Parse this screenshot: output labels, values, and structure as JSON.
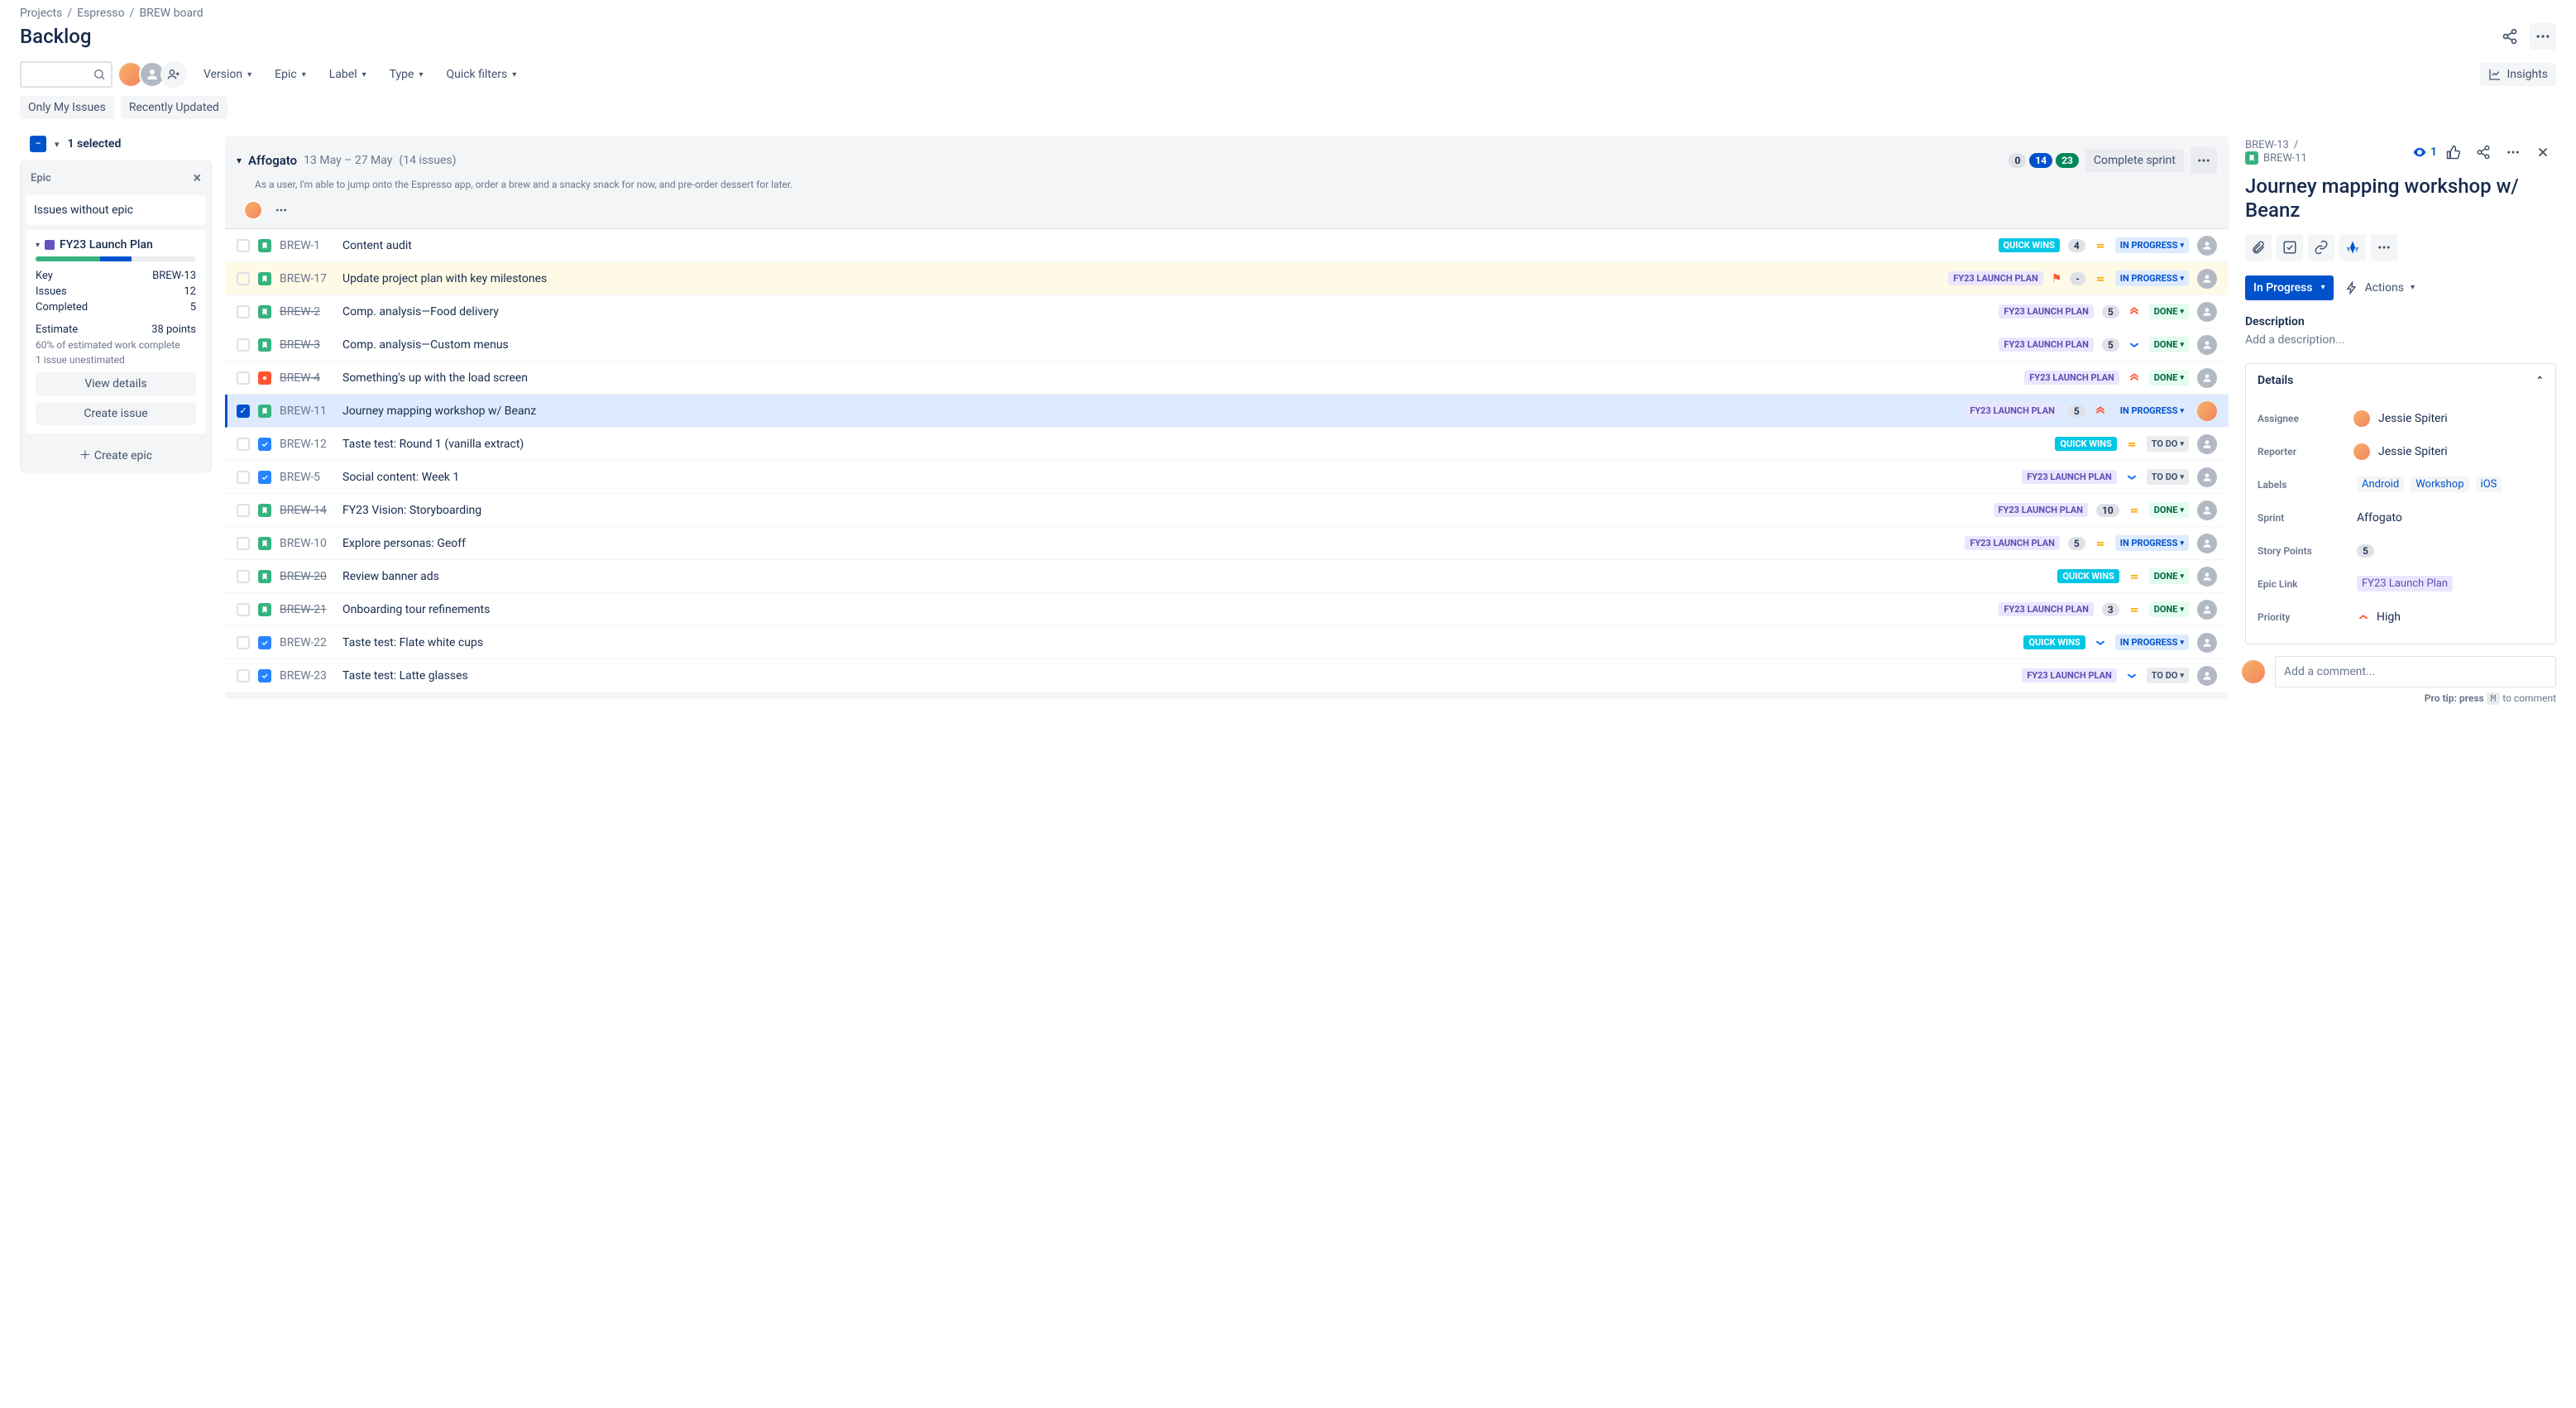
{
  "breadcrumb": [
    "Projects",
    "Espresso",
    "BREW board"
  ],
  "page_title": "Backlog",
  "filters": {
    "items": [
      "Version",
      "Epic",
      "Label",
      "Type",
      "Quick filters"
    ],
    "secondary": [
      "Only My Issues",
      "Recently Updated"
    ],
    "insights": "Insights"
  },
  "selection": {
    "count_label": "1 selected"
  },
  "epic_panel": {
    "title": "Epic",
    "no_epic": "Issues without epic",
    "epic": {
      "name": "FY23 Launch Plan",
      "key_label": "Key",
      "key": "BREW-13",
      "issues_label": "Issues",
      "issues": "12",
      "completed_label": "Completed",
      "completed": "5",
      "estimate_label": "Estimate",
      "estimate": "38 points",
      "sub1": "60% of estimated work complete",
      "sub2": "1 issue unestimated",
      "view_details": "View details",
      "create_issue": "Create issue"
    },
    "create_epic": "Create epic"
  },
  "sprint": {
    "name": "Affogato",
    "dates": "13 May – 27 May",
    "count": "(14 issues)",
    "goal": "As a user, I'm able to jump onto the Espresso app, order a brew and a snacky snack for now, and pre-order dessert for later.",
    "counts": {
      "todo": "0",
      "inprogress": "14",
      "done": "23"
    },
    "complete": "Complete sprint"
  },
  "statuses": {
    "inprogress": "IN PROGRESS",
    "done": "DONE",
    "todo": "TO DO"
  },
  "epic_badges": {
    "launch": "FY23 LAUNCH PLAN",
    "quick": "QUICK WINS"
  },
  "issues": [
    {
      "key": "BREW-1",
      "strike": false,
      "type": "story",
      "summary": "Content audit",
      "epic": "quick",
      "flag": false,
      "est": "4",
      "prio": "medium",
      "status": "inprogress",
      "assignee": "none",
      "row": ""
    },
    {
      "key": "BREW-17",
      "strike": false,
      "type": "story",
      "summary": "Update project plan with key milestones",
      "epic": "launch",
      "flag": true,
      "est": "-",
      "prio": "medium",
      "status": "inprogress",
      "assignee": "none",
      "row": "yellow"
    },
    {
      "key": "BREW-2",
      "strike": true,
      "type": "story",
      "summary": "Comp. analysis—Food delivery",
      "epic": "launch",
      "flag": false,
      "est": "5",
      "prio": "high",
      "status": "done",
      "assignee": "none",
      "row": ""
    },
    {
      "key": "BREW-3",
      "strike": true,
      "type": "story",
      "summary": "Comp. analysis—Custom menus",
      "epic": "launch",
      "flag": false,
      "est": "5",
      "prio": "low",
      "status": "done",
      "assignee": "none",
      "row": ""
    },
    {
      "key": "BREW-4",
      "strike": true,
      "type": "bug",
      "summary": "Something's up with the load screen",
      "epic": "launch",
      "flag": false,
      "est": "",
      "prio": "high",
      "status": "done",
      "assignee": "none",
      "row": ""
    },
    {
      "key": "BREW-11",
      "strike": false,
      "type": "story",
      "summary": "Journey mapping workshop w/ Beanz",
      "epic": "launch",
      "flag": false,
      "est": "5",
      "prio": "high",
      "status": "inprogress",
      "assignee": "js",
      "row": "selected"
    },
    {
      "key": "BREW-12",
      "strike": false,
      "type": "task",
      "summary": "Taste test: Round 1 (vanilla extract)",
      "epic": "quick",
      "flag": false,
      "est": "",
      "prio": "medium",
      "status": "todo",
      "assignee": "none",
      "row": ""
    },
    {
      "key": "BREW-5",
      "strike": false,
      "type": "task",
      "summary": "Social content: Week 1",
      "epic": "launch",
      "flag": false,
      "est": "",
      "prio": "low",
      "status": "todo",
      "assignee": "none",
      "row": ""
    },
    {
      "key": "BREW-14",
      "strike": true,
      "type": "story",
      "summary": "FY23 Vision: Storyboarding",
      "epic": "launch",
      "flag": false,
      "est": "10",
      "prio": "medium",
      "status": "done",
      "assignee": "none",
      "row": ""
    },
    {
      "key": "BREW-10",
      "strike": false,
      "type": "story",
      "summary": "Explore personas: Geoff",
      "epic": "launch",
      "flag": false,
      "est": "5",
      "prio": "medium",
      "status": "inprogress",
      "assignee": "none",
      "row": ""
    },
    {
      "key": "BREW-20",
      "strike": true,
      "type": "story",
      "summary": "Review banner ads",
      "epic": "quick",
      "flag": false,
      "est": "",
      "prio": "medium",
      "status": "done",
      "assignee": "none",
      "row": ""
    },
    {
      "key": "BREW-21",
      "strike": true,
      "type": "story",
      "summary": "Onboarding tour refinements",
      "epic": "launch",
      "flag": false,
      "est": "3",
      "prio": "medium",
      "status": "done",
      "assignee": "none",
      "row": ""
    },
    {
      "key": "BREW-22",
      "strike": false,
      "type": "task",
      "summary": "Taste test: Flate white cups",
      "epic": "quick",
      "flag": false,
      "est": "",
      "prio": "low",
      "status": "inprogress",
      "assignee": "none",
      "row": ""
    },
    {
      "key": "BREW-23",
      "strike": false,
      "type": "task",
      "summary": "Taste test: Latte glasses",
      "epic": "launch",
      "flag": false,
      "est": "",
      "prio": "low",
      "status": "todo",
      "assignee": "none",
      "row": ""
    }
  ],
  "detail": {
    "parent_key": "BREW-13",
    "key": "BREW-11",
    "watch_count": "1",
    "title": "Journey mapping workshop w/ Beanz",
    "status": "In Progress",
    "actions": "Actions",
    "desc_hd": "Description",
    "desc_placeholder": "Add a description...",
    "details_hd": "Details",
    "fields": {
      "assignee_label": "Assignee",
      "assignee": "Jessie Spiteri",
      "reporter_label": "Reporter",
      "reporter": "Jessie Spiteri",
      "labels_label": "Labels",
      "labels": [
        "Android",
        "Workshop",
        "iOS"
      ],
      "sprint_label": "Sprint",
      "sprint": "Affogato",
      "story_points_label": "Story Points",
      "story_points": "5",
      "epic_link_label": "Epic Link",
      "epic_link": "FY23 Launch Plan",
      "priority_label": "Priority",
      "priority": "High"
    },
    "comment_placeholder": "Add a comment...",
    "protip_pre": "Pro tip: press",
    "protip_key": "M",
    "protip_post": "to comment"
  }
}
